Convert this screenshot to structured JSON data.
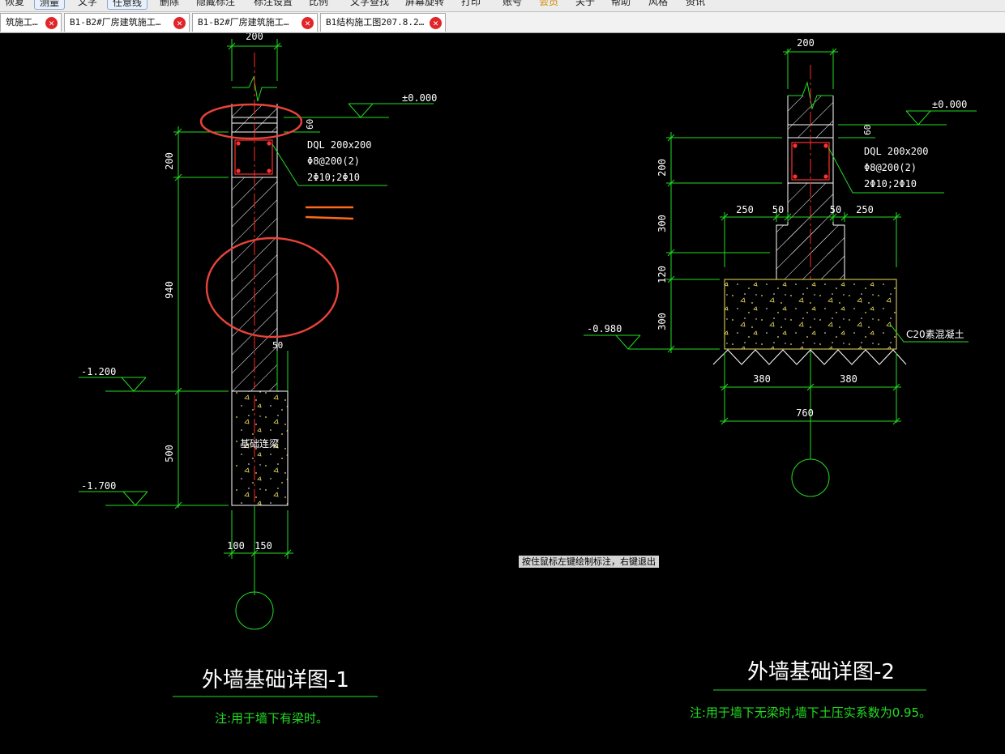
{
  "toolbar": {
    "items": [
      "恢复",
      "测量",
      "文字",
      "任意线",
      "删除",
      "隐藏标注",
      "标注设置",
      "比例",
      "文字查找",
      "屏幕旋转",
      "打印",
      "账号",
      "会员",
      "关于",
      "帮助",
      "风格",
      "资讯"
    ]
  },
  "tabs": [
    {
      "label": "筑施工…"
    },
    {
      "label": "B1-B2#厂房建筑施工…"
    },
    {
      "label": "B1-B2#厂房建筑施工…"
    },
    {
      "label": "B1结构施工图207.8.2…"
    }
  ],
  "drawing1": {
    "dim_top": "200",
    "elev_top": "±0.000",
    "dim_60": "60",
    "beam_label": "DQL 200x200",
    "stirrup": "Φ8@200(2)",
    "rebar": "2Φ10;2Φ10",
    "dim_200": "200",
    "dim_940": "940",
    "dim_50": "50",
    "elev_mid": "-1.200",
    "beam_name": "基础连梁",
    "dim_500": "500",
    "elev_bottom": "-1.700",
    "dim_100": "100",
    "dim_150": "150",
    "title": "外墙基础详图-1",
    "note": "注:用于墙下有梁时。"
  },
  "drawing2": {
    "dim_top": "200",
    "elev_top": "±0.000",
    "dim_60": "60",
    "beam_label": "DQL 200x200",
    "stirrup": "Φ8@200(2)",
    "rebar": "2Φ10;2Φ10",
    "dim_200": "200",
    "dim_250_left": "250",
    "dim_50_left": "50",
    "dim_50_right": "50",
    "dim_250_right": "250",
    "dim_300_top": "300",
    "dim_120": "120",
    "dim_300_bottom": "300",
    "elev_bottom": "-0.980",
    "concrete": "C20素混凝土",
    "dim_380_left": "380",
    "dim_380_right": "380",
    "dim_760": "760",
    "title": "外墙基础详图-2",
    "note": "注:用于墙下无梁时,墙下土压实系数为0.95。"
  },
  "status": {
    "tip": "按住鼠标左键绘制标注，右键退出"
  },
  "colors": {
    "background": "#000000",
    "green": "#22dd22",
    "white": "#ffffff",
    "yellow": "#f0e060",
    "red_axis": "#ff2a2a",
    "markup_red": "#e8433a",
    "markup_orange": "#ff6a1a"
  }
}
